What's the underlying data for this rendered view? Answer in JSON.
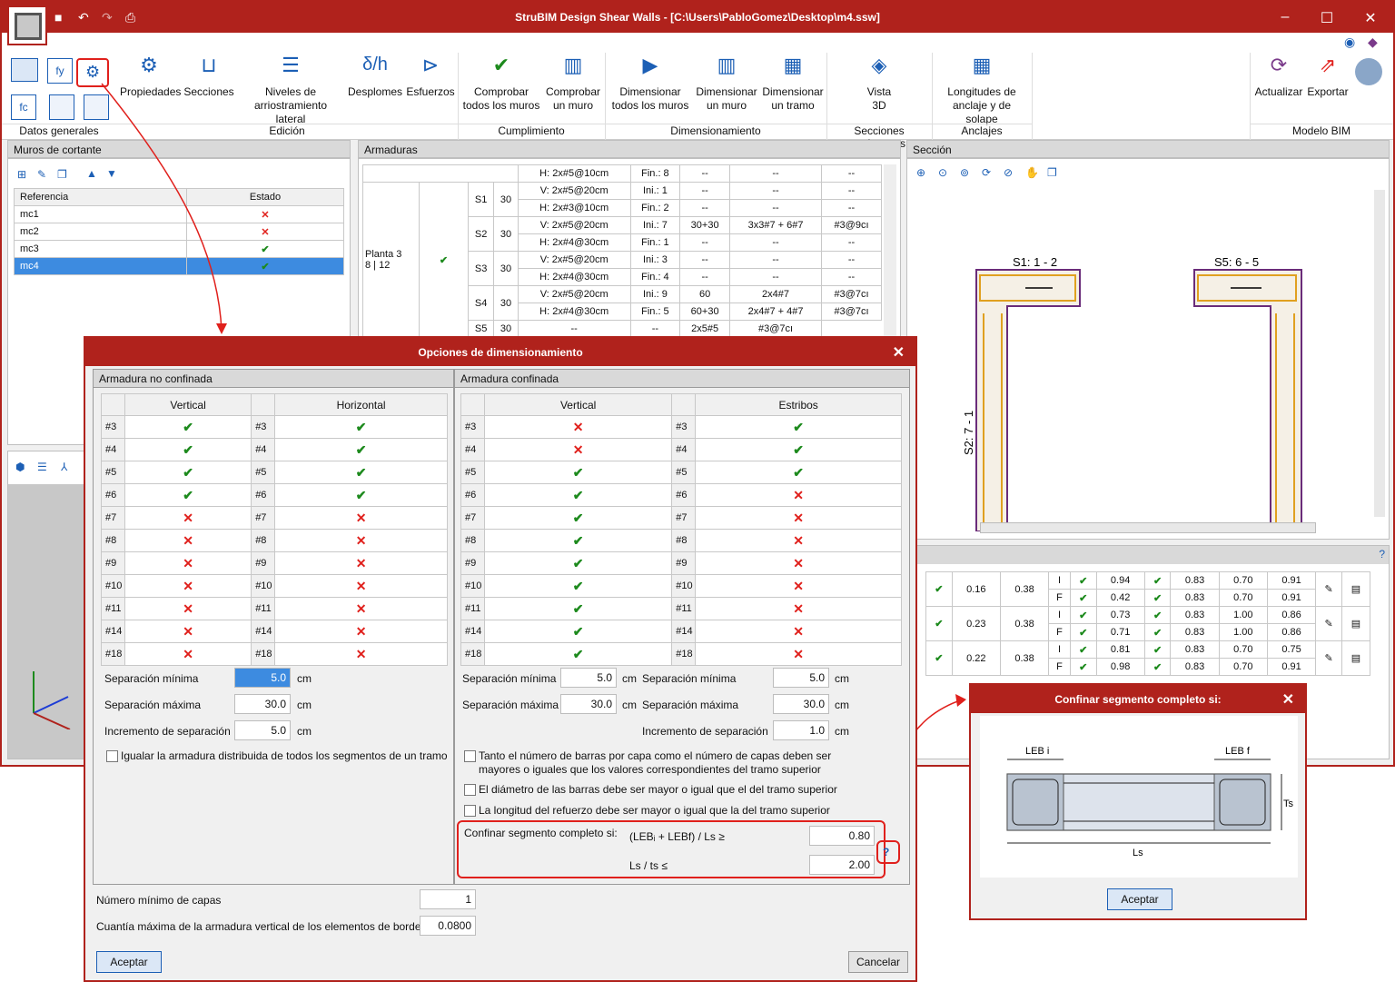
{
  "app": {
    "title": "StruBIM Design Shear Walls - [C:\\Users\\PabloGomez\\Desktop\\m4.ssw]"
  },
  "ribbon": {
    "general_label": "Datos generales",
    "buttons": [
      {
        "id": "propiedades",
        "label": "Propiedades"
      },
      {
        "id": "secciones",
        "label": "Secciones"
      },
      {
        "id": "niveles",
        "label": "Niveles de\narriostramiento lateral"
      },
      {
        "id": "desplomes",
        "label": "Desplomes"
      },
      {
        "id": "esfuerzos",
        "label": "Esfuerzos"
      },
      {
        "id": "comprobar_todos",
        "label": "Comprobar\ntodos los muros"
      },
      {
        "id": "comprobar_uno",
        "label": "Comprobar\nun muro"
      },
      {
        "id": "dimensionar_todos",
        "label": "Dimensionar\ntodos los muros"
      },
      {
        "id": "dimensionar_uno",
        "label": "Dimensionar\nun muro"
      },
      {
        "id": "dimensionar_tramo",
        "label": "Dimensionar\nun tramo"
      },
      {
        "id": "vista3d",
        "label": "Vista\n3D"
      },
      {
        "id": "longitudes",
        "label": "Longitudes de\nanclaje y de solape"
      },
      {
        "id": "actualizar",
        "label": "Actualizar"
      },
      {
        "id": "exportar",
        "label": "Exportar"
      }
    ],
    "groups": [
      "Edición",
      "Cumplimiento",
      "Dimensionamiento",
      "Secciones resistentes",
      "Anclajes",
      "Modelo BIM"
    ]
  },
  "walls_panel": {
    "title": "Muros de cortante",
    "col_ref": "Referencia",
    "col_state": "Estado",
    "rows": [
      {
        "ref": "mc1",
        "ok": false
      },
      {
        "ref": "mc2",
        "ok": false
      },
      {
        "ref": "mc3",
        "ok": true
      },
      {
        "ref": "mc4",
        "ok": true
      }
    ]
  },
  "armaduras_panel": {
    "title": "Armaduras",
    "rows": [
      [
        "H: 2x#5@10cm",
        "Fin.: 8",
        "--",
        "--",
        "--"
      ],
      [
        "V: 2x#5@20cm",
        "Ini.: 1",
        "--",
        "--",
        "--"
      ],
      [
        "H: 2x#3@10cm",
        "Fin.: 2",
        "--",
        "--",
        "--"
      ],
      [
        "V: 2x#5@20cm",
        "Ini.: 7",
        "30+30",
        "3x3#7 + 6#7",
        "#3@9cı"
      ],
      [
        "H: 2x#4@30cm",
        "Fin.: 1",
        "--",
        "--",
        "--"
      ],
      [
        "V: 2x#5@20cm",
        "Ini.: 3",
        "--",
        "--",
        "--"
      ],
      [
        "H: 2x#4@30cm",
        "Fin.: 4",
        "--",
        "--",
        "--"
      ],
      [
        "V: 2x#5@20cm",
        "Ini.: 9",
        "60",
        "2x4#7",
        "#3@7cı"
      ],
      [
        "H: 2x#4@30cm",
        "Fin.: 5",
        "60+30",
        "2x4#7 + 4#7",
        "#3@7cı"
      ]
    ],
    "segments": [
      {
        "s": "S1",
        "t": "30"
      },
      {
        "s": "S2",
        "t": "30"
      },
      {
        "s": "S3",
        "t": "30"
      },
      {
        "s": "S4",
        "t": "30"
      }
    ],
    "s5": {
      "s": "S5",
      "t": "30",
      "a": "--",
      "b": "--",
      "c": "2x5#5",
      "d": "#3@7cı"
    },
    "floor": "Planta 3\n8 | 12"
  },
  "section_panel": {
    "title": "Sección",
    "label_s1": "S1: 1 - 2",
    "label_s5": "S5: 6 - 5",
    "label_s2": "S2: 7 - 1"
  },
  "results": [
    {
      "a": "0.16",
      "b": "0.38",
      "r1": [
        "I",
        "0.94",
        "0.83",
        "0.70",
        "0.91"
      ],
      "r2": [
        "F",
        "0.42",
        "0.83",
        "0.70",
        "0.91"
      ]
    },
    {
      "a": "0.23",
      "b": "0.38",
      "r1": [
        "I",
        "0.73",
        "0.83",
        "1.00",
        "0.86"
      ],
      "r2": [
        "F",
        "0.71",
        "0.83",
        "1.00",
        "0.86"
      ]
    },
    {
      "a": "0.22",
      "b": "0.38",
      "r1": [
        "I",
        "0.81",
        "0.83",
        "0.70",
        "0.75"
      ],
      "r2": [
        "F",
        "0.98",
        "0.83",
        "0.70",
        "0.91"
      ]
    }
  ],
  "dialog": {
    "title": "Opciones de dimensionamiento",
    "unconfined": {
      "title": "Armadura no confinada",
      "col_v": "Vertical",
      "col_h": "Horizontal"
    },
    "confined": {
      "title": "Armadura confinada",
      "col_v": "Vertical",
      "col_e": "Estribos"
    },
    "bars": [
      "#3",
      "#4",
      "#5",
      "#6",
      "#7",
      "#8",
      "#9",
      "#10",
      "#11",
      "#14",
      "#18"
    ],
    "unconf_v": [
      true,
      true,
      true,
      true,
      false,
      false,
      false,
      false,
      false,
      false,
      false
    ],
    "unconf_h": [
      true,
      true,
      true,
      true,
      false,
      false,
      false,
      false,
      false,
      false,
      false
    ],
    "conf_v": [
      false,
      false,
      true,
      true,
      true,
      true,
      true,
      true,
      true,
      true,
      true
    ],
    "conf_e": [
      true,
      true,
      true,
      false,
      false,
      false,
      false,
      false,
      false,
      false,
      false
    ],
    "sep_min_label": "Separación mínima",
    "sep_max_label": "Separación máxima",
    "sep_inc_label": "Incremento de separación",
    "unit": "cm",
    "u_sep_min": "5.0",
    "u_sep_max": "30.0",
    "u_sep_inc": "5.0",
    "c_sep_min": "5.0",
    "c_sep_max": "30.0",
    "e_sep_min": "5.0",
    "e_sep_max": "30.0",
    "e_sep_inc": "1.0",
    "cb_igualar": "Igualar la armadura distribuida de todos los segmentos de un tramo",
    "cb_tanto": "Tanto el número de barras por capa como el número de capas deben ser\nmayores o iguales que los valores correspondientes del tramo superior",
    "cb_diam": "El diámetro de las barras debe ser mayor o igual que el del tramo superior",
    "cb_long": "La longitud del refuerzo debe ser mayor o igual que la del tramo superior",
    "confinar_label": "Confinar segmento completo si:",
    "formula1": "(LEBᵢ + LEBf) / Ls ≥",
    "value1": "0.80",
    "formula2": "Ls / ts ≤",
    "value2": "2.00",
    "min_capas_label": "Número mínimo de capas",
    "min_capas": "1",
    "cuantia_label": "Cuantía máxima de la armadura vertical de los elementos de borde",
    "cuantia": "0.0800",
    "accept": "Aceptar",
    "cancel": "Cancelar"
  },
  "dialog2": {
    "title": "Confinar segmento completo si:",
    "leb_i": "LEB i",
    "leb_f": "LEB f",
    "ts": "Ts",
    "ls": "Ls",
    "accept": "Aceptar"
  },
  "colors": {
    "accent": "#b0221c",
    "ok": "#1d8a1d",
    "bad": "#e0201c",
    "selection": "#3d8be0"
  }
}
